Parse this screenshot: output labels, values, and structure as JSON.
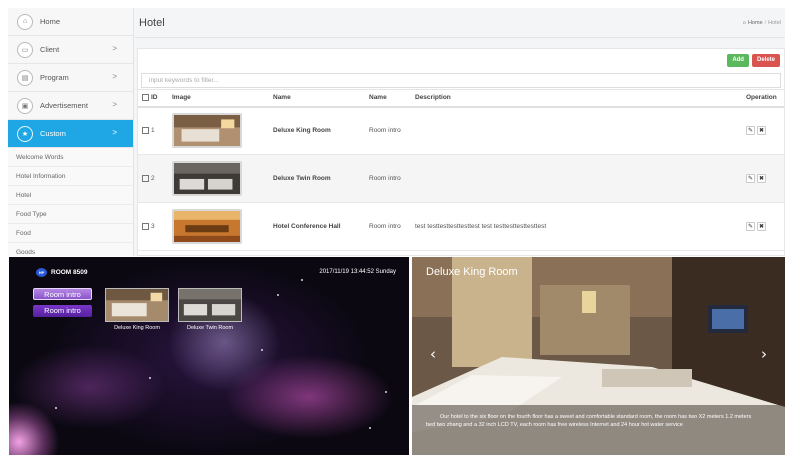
{
  "admin": {
    "sidebar": {
      "items": [
        {
          "label": "Home",
          "icon": "home-icon",
          "glyph": "⌂",
          "has_chevron": false
        },
        {
          "label": "Client",
          "icon": "monitor-icon",
          "glyph": "▭",
          "has_chevron": true
        },
        {
          "label": "Program",
          "icon": "film-icon",
          "glyph": "▤",
          "has_chevron": true
        },
        {
          "label": "Advertisement",
          "icon": "image-icon",
          "glyph": "▣",
          "has_chevron": true
        },
        {
          "label": "Custom",
          "icon": "star-icon",
          "glyph": "★",
          "has_chevron": true,
          "active": true
        }
      ],
      "subitems": [
        "Welcome Words",
        "Hotel Information",
        "Hotel",
        "Food Type",
        "Food",
        "Goods"
      ],
      "chevron": ">"
    },
    "header": {
      "title": "Hotel",
      "breadcrumb": {
        "home": "Home",
        "sep": "/",
        "current": "Hotel"
      }
    },
    "toolbar": {
      "add_label": "Add",
      "delete_label": "Delete"
    },
    "filter": {
      "placeholder": "input keywords to filter..."
    },
    "table": {
      "columns": {
        "id": "ID",
        "image": "Image",
        "name": "Name",
        "name2": "Name",
        "description": "Description",
        "operation": "Operation"
      },
      "rows": [
        {
          "id": "1",
          "name": "Deluxe King Room",
          "type": "Room intro",
          "description": ""
        },
        {
          "id": "2",
          "name": "Deluxe Twin Room",
          "type": "Room intro",
          "description": ""
        },
        {
          "id": "3",
          "name": "Hotel Conference Hall",
          "type": "Room intro",
          "description": "test testtesttesttesttest test testtesttesttesttest"
        }
      ]
    }
  },
  "tv": {
    "logo_text": "HP",
    "room": "ROOM 8509",
    "clock": "2017/11/19  13:44:52  Sunday",
    "menu": [
      "Room intro",
      "Room intro"
    ],
    "cards": [
      {
        "caption": "Deluxe King Room"
      },
      {
        "caption": "Deluxe Twin Room"
      }
    ]
  },
  "detail": {
    "title": "Deluxe King Room",
    "prev_glyph": "‹",
    "next_glyph": "›",
    "description": "Our hotel to the six floor on the fourth floor has a sweet and comfortable standard room, the room has two X2 meters 1.2 meters bed two zhang and a 32 inch LCD TV, each room has free wireless Internet and 24 hour hot water service"
  },
  "colors": {
    "accent": "#1ea7e4",
    "add": "#5cb85c",
    "delete": "#d9534f"
  }
}
